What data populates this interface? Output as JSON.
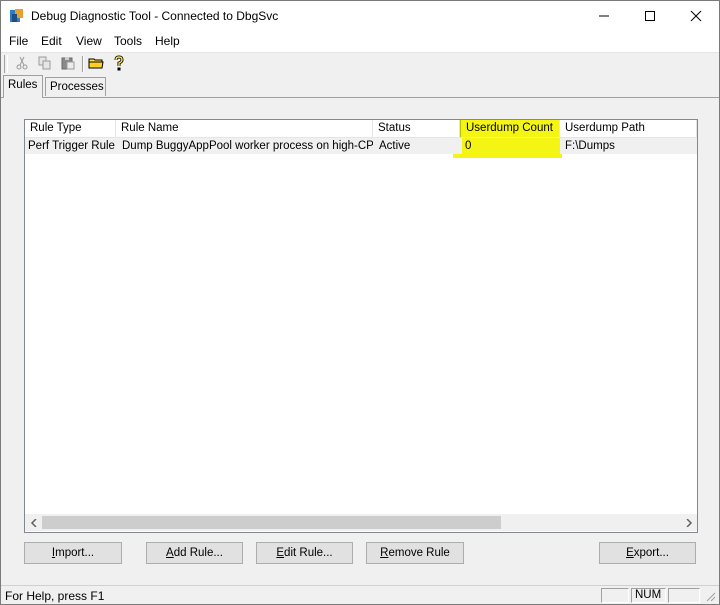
{
  "window": {
    "title": "Debug Diagnostic Tool - Connected to DbgSvc"
  },
  "menu": {
    "items": [
      "File",
      "Edit",
      "View",
      "Tools",
      "Help"
    ]
  },
  "tabs": [
    {
      "label": "Rules"
    },
    {
      "label": "Processes"
    }
  ],
  "list": {
    "columns": [
      "Rule Type",
      "Rule Name",
      "Status",
      "Userdump Count",
      "Userdump Path"
    ],
    "rows": [
      {
        "rule_type": "Perf Trigger Rule",
        "rule_name": "Dump BuggyAppPool worker process on high-CPU",
        "status": "Active",
        "userdump_count": "0",
        "userdump_path": "F:\\Dumps"
      }
    ]
  },
  "buttons": {
    "import": {
      "hot": "I",
      "rest": "mport..."
    },
    "add_rule": {
      "hot": "A",
      "rest": "dd Rule..."
    },
    "edit_rule": {
      "hot": "E",
      "rest": "dit Rule..."
    },
    "remove_rule": {
      "hot": "R",
      "rest": "emove Rule"
    },
    "export": {
      "hot": "E",
      "rest": "xport..."
    }
  },
  "statusbar": {
    "help_text": "For Help, press F1",
    "num_indicator": "NUM"
  },
  "colors": {
    "highlight": "#f5f514",
    "row_bg": "#f0f0f0"
  }
}
